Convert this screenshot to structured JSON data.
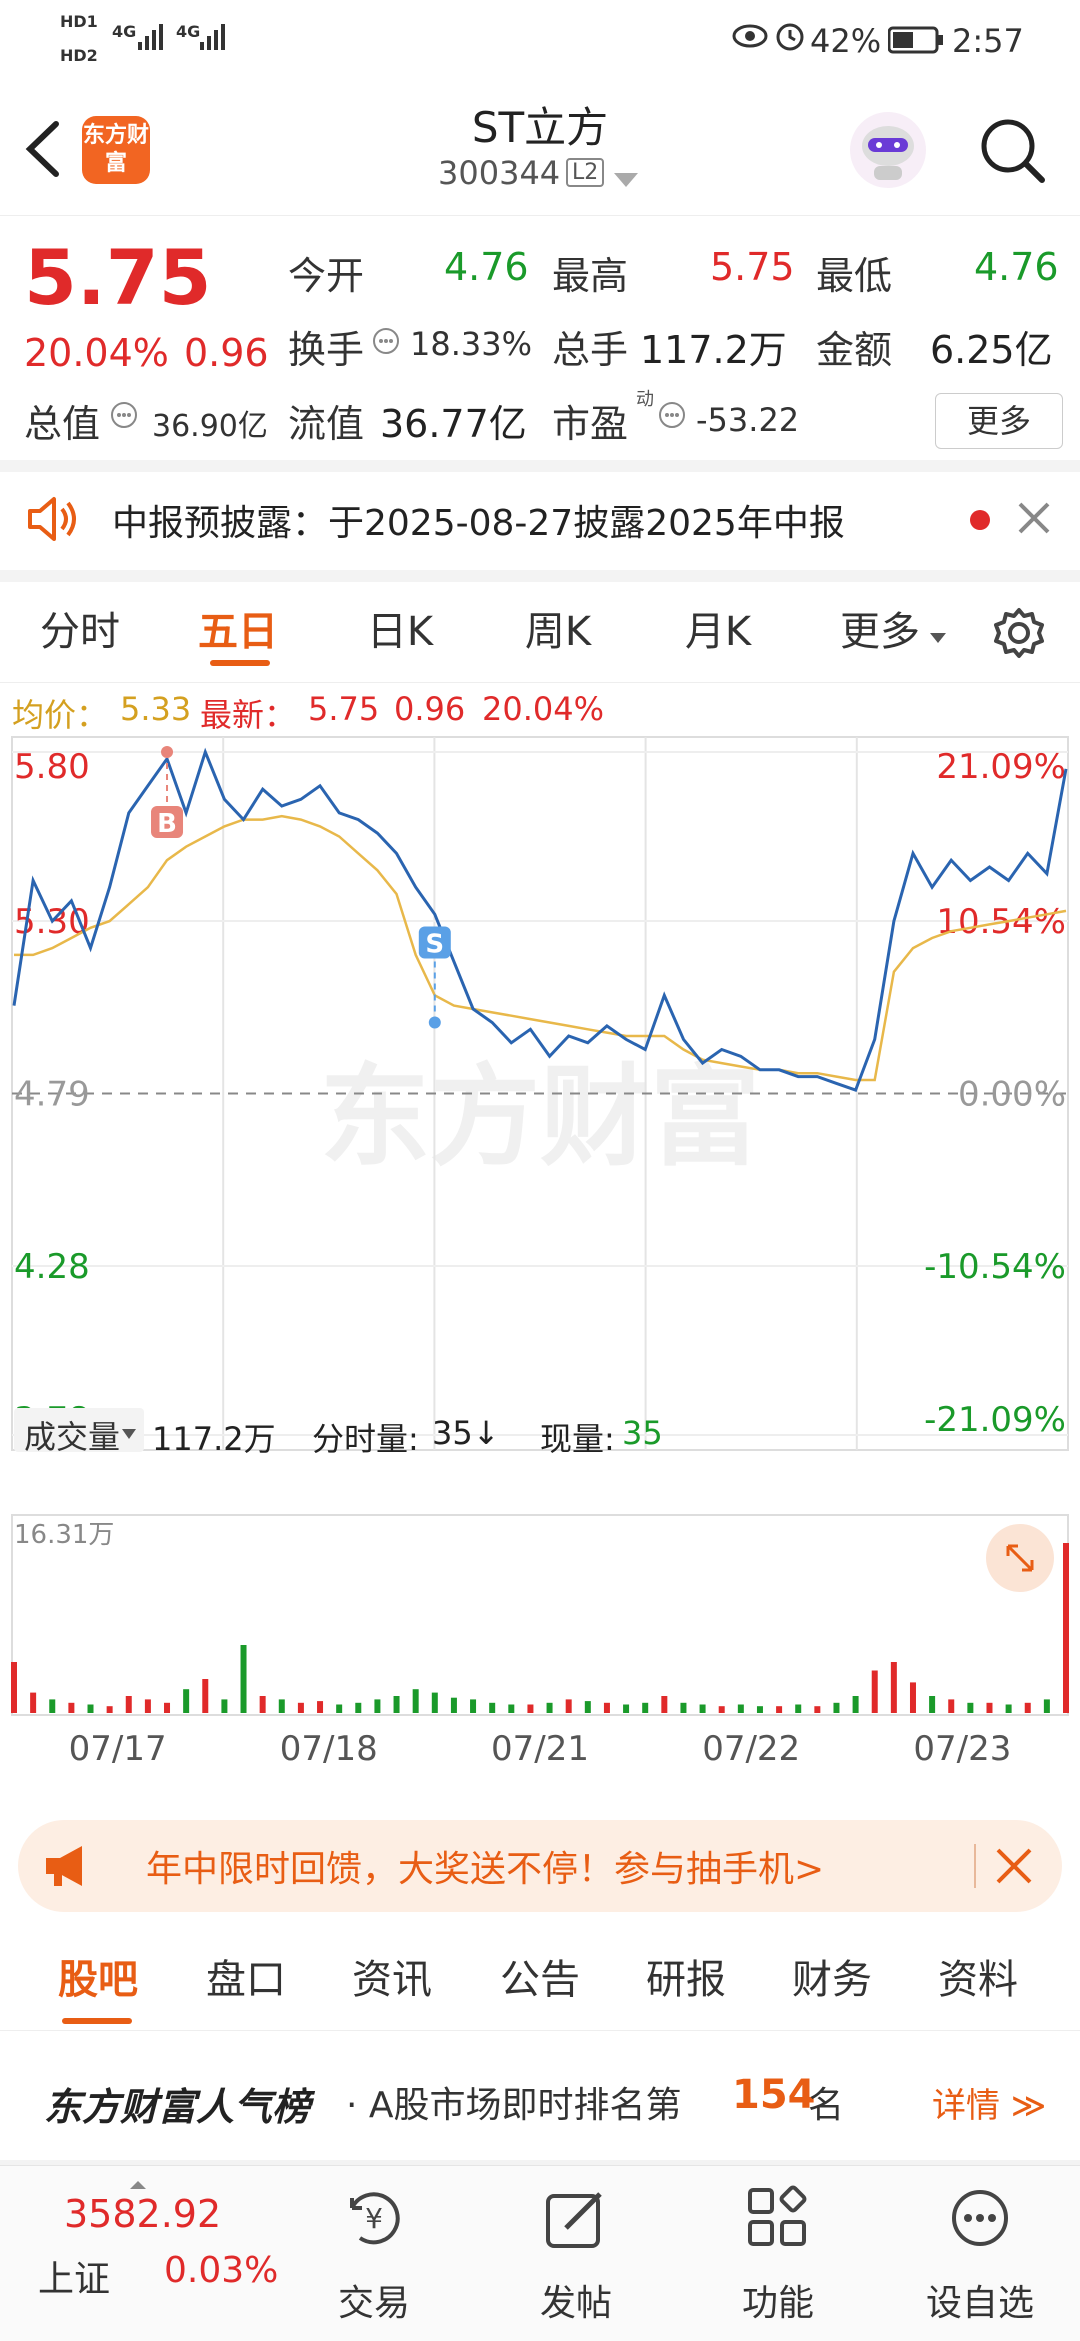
{
  "status": {
    "sim1": "HD1",
    "sim2": "HD2",
    "net1": "4G",
    "net2": "4G",
    "battery": "42%",
    "time": "2:57"
  },
  "header": {
    "logo_text": "东方财富",
    "title": "ST立方",
    "code": "300344",
    "level": "L2"
  },
  "quote": {
    "price": "5.75",
    "change_pct": "20.04%",
    "change": "0.96",
    "open_label": "今开",
    "open": "4.76",
    "high_label": "最高",
    "high": "5.75",
    "low_label": "最低",
    "low": "4.76",
    "turnover_label": "换手",
    "turnover": "18.33%",
    "volume_label": "总手",
    "volume": "117.2万",
    "amount_label": "金额",
    "amount": "6.25亿",
    "mktcap_label": "总值",
    "mktcap": "36.90亿",
    "float_label": "流值",
    "float": "36.77亿",
    "pe_label": "市盈",
    "pe_sup": "动",
    "pe": "-53.22",
    "more_label": "更多"
  },
  "notice": {
    "text": "中报预披露：于2025-08-27披露2025年中报"
  },
  "tabs": [
    "分时",
    "五日",
    "日K",
    "周K",
    "月K",
    "更多"
  ],
  "active_tab": 1,
  "chart_info": {
    "avg_label": "均价：",
    "avg": "5.33",
    "latest_label": "最新：",
    "latest": "5.75",
    "latest_change": "0.96",
    "latest_pct": "20.04%",
    "watermark": "东方财富",
    "volume_label": "成交量",
    "volume_total": "117.2万",
    "tick_label": "分时量:",
    "tick_value": "35↓",
    "now_label": "现量:",
    "now_value": "35",
    "vol_max_label": "16.31万"
  },
  "chart_data": {
    "type": "line",
    "y_left_ticks": [
      "5.80",
      "5.30",
      "4.79",
      "4.28",
      "3.78"
    ],
    "y_right_ticks": [
      "21.09%",
      "10.54%",
      "0.00%",
      "-10.54%",
      "-21.09%"
    ],
    "ylim": [
      3.78,
      5.8
    ],
    "prev_close": 4.79,
    "x_labels": [
      "07/17",
      "07/18",
      "07/21",
      "07/22",
      "07/23"
    ],
    "series": [
      {
        "name": "最新",
        "values": [
          5.05,
          5.42,
          5.3,
          5.36,
          5.22,
          5.4,
          5.62,
          5.7,
          5.78,
          5.62,
          5.8,
          5.66,
          5.6,
          5.69,
          5.64,
          5.66,
          5.7,
          5.62,
          5.6,
          5.56,
          5.5,
          5.4,
          5.32,
          5.18,
          5.04,
          5.0,
          4.94,
          4.98,
          4.9,
          4.96,
          4.94,
          4.99,
          4.95,
          4.92,
          5.08,
          4.95,
          4.88,
          4.92,
          4.9,
          4.86,
          4.86,
          4.84,
          4.84,
          4.82,
          4.8,
          4.95,
          5.3,
          5.5,
          5.4,
          5.48,
          5.42,
          5.46,
          5.42,
          5.5,
          5.44,
          5.75
        ]
      },
      {
        "name": "均价",
        "values": [
          5.2,
          5.2,
          5.22,
          5.25,
          5.28,
          5.3,
          5.35,
          5.4,
          5.48,
          5.52,
          5.55,
          5.58,
          5.6,
          5.6,
          5.61,
          5.6,
          5.58,
          5.55,
          5.5,
          5.45,
          5.38,
          5.2,
          5.08,
          5.05,
          5.04,
          5.03,
          5.02,
          5.01,
          5.0,
          4.99,
          4.98,
          4.97,
          4.96,
          4.96,
          4.96,
          4.92,
          4.89,
          4.88,
          4.87,
          4.86,
          4.86,
          4.85,
          4.85,
          4.84,
          4.83,
          4.83,
          5.15,
          5.22,
          5.25,
          5.27,
          5.28,
          5.29,
          5.3,
          5.31,
          5.32,
          5.33
        ]
      }
    ],
    "markers": [
      {
        "label": "B",
        "x": 8,
        "price": 5.8
      },
      {
        "label": "S",
        "x": 22,
        "price": 5.0
      }
    ],
    "volume_ylim_label": "16.31万",
    "volume": [
      30,
      12,
      8,
      6,
      5,
      4,
      10,
      8,
      6,
      14,
      20,
      8,
      40,
      10,
      8,
      6,
      7,
      5,
      6,
      8,
      10,
      14,
      12,
      9,
      8,
      6,
      5,
      5,
      6,
      8,
      7,
      6,
      5,
      6,
      10,
      6,
      5,
      4,
      5,
      4,
      4,
      5,
      4,
      6,
      10,
      25,
      30,
      18,
      10,
      8,
      6,
      6,
      5,
      6,
      8,
      100
    ]
  },
  "banner": {
    "text": "年中限时回馈，大奖送不停！参与抽手机>"
  },
  "bottom_tabs": [
    "股吧",
    "盘口",
    "资讯",
    "公告",
    "研报",
    "财务",
    "资料"
  ],
  "rank": {
    "brand": "东方财富人气榜",
    "text_pre": "· A股市场即时排名第",
    "rank": "154",
    "text_post": "名",
    "detail": "详情 ≫"
  },
  "nav": {
    "index_value": "3582.92",
    "index_name": "上证",
    "index_pct": "0.03%",
    "items": [
      "交易",
      "发帖",
      "功能",
      "设自选"
    ]
  },
  "colors": {
    "up": "#e02a2a",
    "down": "#1a9a2a",
    "price_line": "#2a64b0",
    "avg_line": "#e8b84a",
    "accent": "#e85d14"
  }
}
